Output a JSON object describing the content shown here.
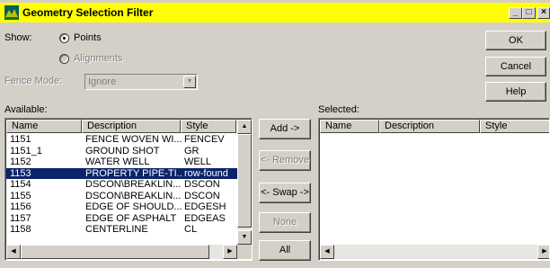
{
  "window": {
    "title": "Geometry Selection Filter",
    "controls": {
      "minimize": "_",
      "maximize": "□",
      "close": "×"
    }
  },
  "show": {
    "label": "Show:",
    "options": [
      {
        "label": "Points",
        "selected": true,
        "enabled": true
      },
      {
        "label": "Alignments",
        "selected": false,
        "enabled": false
      }
    ]
  },
  "fence": {
    "label": "Fence Mode:",
    "value": "Ignore"
  },
  "buttons": {
    "ok": "OK",
    "cancel": "Cancel",
    "help": "Help"
  },
  "available": {
    "label": "Available:",
    "columns": [
      "Name",
      "Description",
      "Style"
    ],
    "rows": [
      [
        "1151",
        "FENCE WOVEN WI...",
        "FENCEV"
      ],
      [
        "1151_1",
        "GROUND SHOT",
        "GR"
      ],
      [
        "1152",
        "WATER WELL",
        "WELL"
      ],
      [
        "1153",
        "PROPERTY PIPE-TI...",
        "row-found"
      ],
      [
        "1154",
        "DSCON\\BREAKLIN...",
        "DSCON"
      ],
      [
        "1155",
        "DSCON\\BREAKLIN...",
        "DSCON"
      ],
      [
        "1156",
        "EDGE OF SHOULD...",
        "EDGESH"
      ],
      [
        "1157",
        "EDGE OF ASPHALT",
        "EDGEAS"
      ],
      [
        "1158",
        "CENTERLINE",
        "CL"
      ]
    ],
    "selected_index": 3
  },
  "mid_buttons": {
    "add": "Add ->",
    "remove": "<- Remove",
    "swap": "<- Swap ->",
    "none": "None",
    "all": "All"
  },
  "selected": {
    "label": "Selected:",
    "columns": [
      "Name",
      "Description",
      "Style"
    ]
  },
  "colors": {
    "titlebar": "#ffff00",
    "selection": "#0a246a",
    "face": "#d4d0c8"
  }
}
